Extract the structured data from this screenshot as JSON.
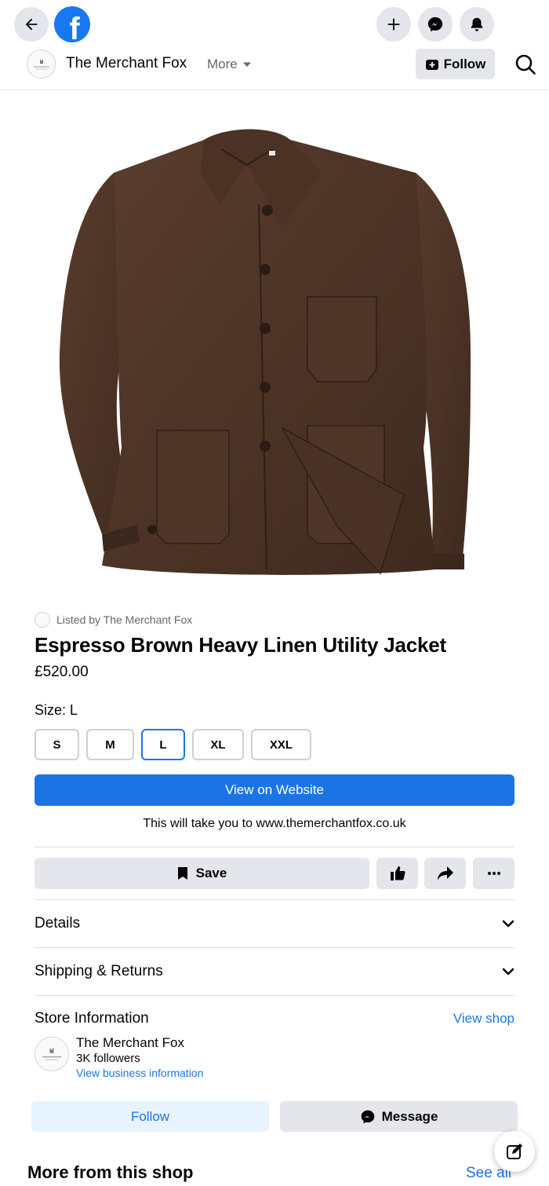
{
  "header": {
    "brand": "f",
    "page_name": "The Merchant Fox",
    "more_label": "More",
    "follow_label": "Follow",
    "icons": [
      "back-arrow-icon",
      "facebook-logo-icon",
      "plus-icon",
      "messenger-icon",
      "bell-icon",
      "search-icon"
    ]
  },
  "product": {
    "listed_by": "Listed by The Merchant Fox",
    "title": "Espresso Brown Heavy Linen Utility Jacket",
    "price": "£520.00",
    "image_desc": "brown linen utility jacket",
    "color_main": "#4a3226"
  },
  "size": {
    "label": "Size: L",
    "options": [
      "S",
      "M",
      "L",
      "XL",
      "XXL"
    ],
    "selected": "L"
  },
  "actions": {
    "view_website_label": "View on Website",
    "website_note": "This will take you to www.themerchantfox.co.uk",
    "save_label": "Save"
  },
  "sections": {
    "details": "Details",
    "shipping": "Shipping & Returns"
  },
  "store": {
    "heading": "Store Information",
    "view_shop": "View shop",
    "name": "The Merchant Fox",
    "followers": "3K followers",
    "business_info": "View business information",
    "follow_label": "Follow",
    "message_label": "Message"
  },
  "more_from_shop": {
    "heading": "More from this shop",
    "see_all": "See all"
  },
  "colors": {
    "accent": "#1877f2",
    "link": "#1b74e4",
    "button_gray": "#e4e6eb"
  }
}
